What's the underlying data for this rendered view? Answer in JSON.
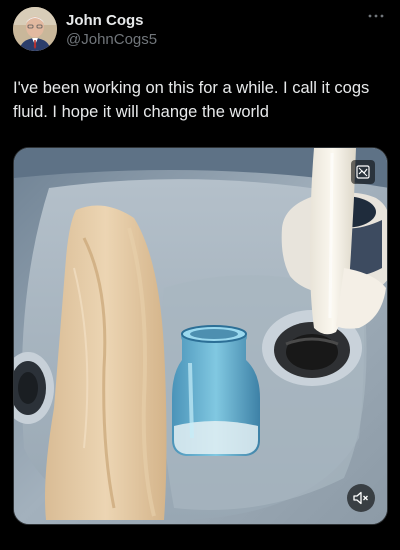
{
  "author": {
    "display_name": "John Cogs",
    "handle": "@JohnCogs5"
  },
  "tweet": {
    "text": "I've been working on this for a while. I call it cogs fluid. I hope it will change the world"
  },
  "media": {
    "type": "video",
    "description_icons": [
      "gif-icon",
      "volume-muted-icon"
    ]
  },
  "icons": {
    "more": "more-horizontal-icon"
  },
  "colors": {
    "background": "#000000",
    "text_primary": "#e7e9ea",
    "text_secondary": "#71767b"
  }
}
